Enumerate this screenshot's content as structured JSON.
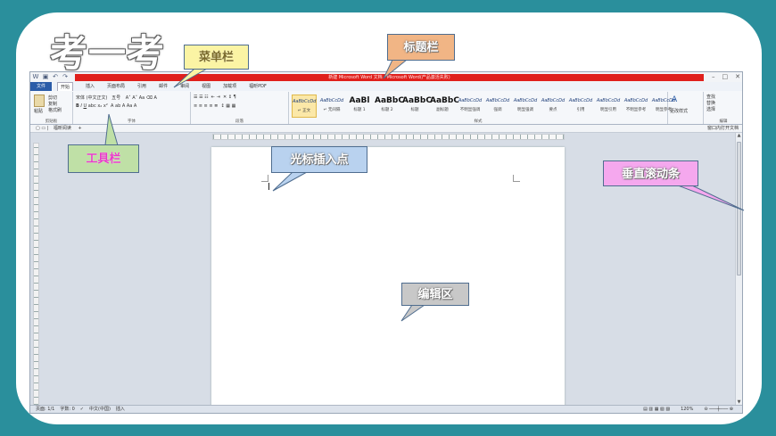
{
  "heading": "考一考",
  "window": {
    "title": "新建 Microsoft Word 文档 - Microsoft Word(产品激活失败)",
    "quick_access": [
      "save-icon",
      "undo-icon",
      "redo-icon"
    ],
    "controls": [
      "minimize-icon",
      "maximize-icon",
      "close-icon"
    ]
  },
  "menubar": {
    "file": "文件",
    "items": [
      "开始",
      "插入",
      "页面布局",
      "引用",
      "邮件",
      "审阅",
      "视图",
      "加载项",
      "福昕PDF"
    ]
  },
  "ribbon": {
    "clipboard": {
      "paste": "粘贴",
      "cut": "剪切",
      "copy": "复制",
      "format_painter": "格式刷",
      "label": "剪贴板"
    },
    "font": {
      "font_name": "宋体 (中文正文)",
      "font_size": "五号",
      "label": "字体"
    },
    "paragraph": {
      "label": "段落"
    },
    "styles": {
      "label": "样式",
      "tiles": [
        {
          "sample": "AaBbCcDd",
          "name": "↵ 正文"
        },
        {
          "sample": "AaBbCcDd",
          "name": "↵ 无间隔"
        },
        {
          "sample": "AaBl",
          "name": "标题 1"
        },
        {
          "sample": "AaBbC",
          "name": "标题 2"
        },
        {
          "sample": "AaBbC",
          "name": "标题"
        },
        {
          "sample": "AaBbC",
          "name": "副标题"
        },
        {
          "sample": "AaBbCcDd",
          "name": "不明显强调"
        },
        {
          "sample": "AaBbCcDd",
          "name": "强调"
        },
        {
          "sample": "AaBbCcDd",
          "name": "明显强调"
        },
        {
          "sample": "AaBbCcDd",
          "name": "要点"
        },
        {
          "sample": "AaBbCcDd",
          "name": "引用"
        },
        {
          "sample": "AaBbCcDd",
          "name": "明显引用"
        },
        {
          "sample": "AaBbCcDd",
          "name": "不明显参考"
        },
        {
          "sample": "AaBbCcDd",
          "name": "明显参考"
        }
      ],
      "change_styles": "更改样式"
    },
    "editing": {
      "find": "查找",
      "replace": "替换",
      "select": "选择",
      "label": "编辑"
    }
  },
  "navbar": {
    "tab": "福昕阅读",
    "right": "窗口内打开文档"
  },
  "statusbar": {
    "page": "页面: 1/1",
    "words": "字数: 0",
    "language": "中文(中国)",
    "mode": "插入",
    "zoom": "120%"
  },
  "callouts": {
    "menu": "菜单栏",
    "title": "标题栏",
    "toolbar": "工具栏",
    "cursor": "光标插入点",
    "scrollbar": "垂直滚动条",
    "edit_area": "编辑区"
  },
  "colors": {
    "background": "#2a8f9c",
    "title_band": "#e0201c",
    "file_tab": "#2b5ca8"
  }
}
